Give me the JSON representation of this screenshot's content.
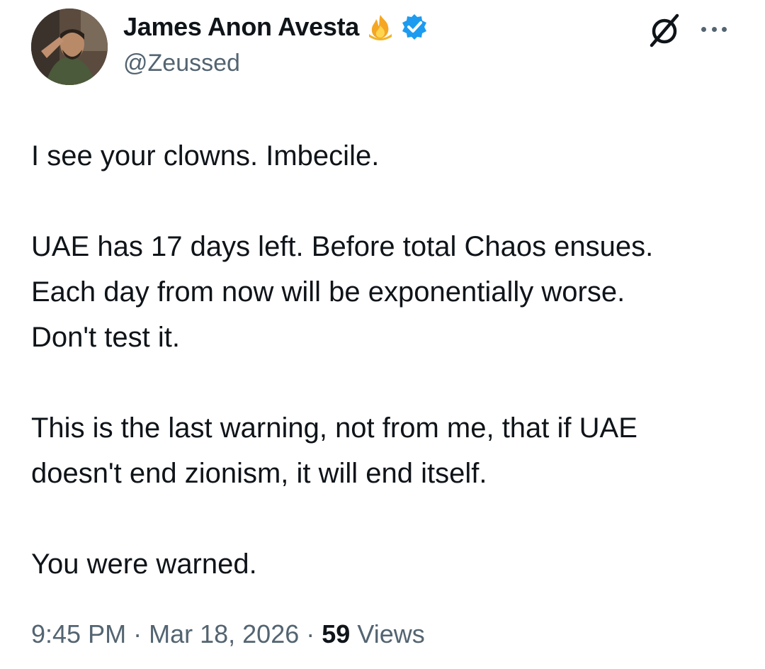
{
  "author": {
    "display_name": "James Anon Avesta",
    "handle": "@Zeussed",
    "badge_icon": "fire-icon",
    "verified_icon": "verified-icon",
    "verified_color": "#1d9bf0"
  },
  "tweet": {
    "paragraphs": [
      [
        "I see your clowns. Imbecile."
      ],
      [
        "UAE has 17 days left. Before total Chaos ensues.",
        "Each day from now will be exponentially worse.",
        "Don't test it."
      ],
      [
        "This is the last warning, not from me, that if UAE",
        "doesn't end zionism, it will end itself."
      ],
      [
        "You were warned."
      ]
    ]
  },
  "meta": {
    "time": "9:45 PM",
    "separator": "·",
    "date": "Mar 18, 2026",
    "views_count": "59",
    "views_label": "Views"
  },
  "actions": {
    "grok_icon": "grok-icon",
    "more_icon": "more-options-icon"
  },
  "colors": {
    "text": "#0f1419",
    "secondary": "#536471",
    "accent": "#1d9bf0"
  }
}
